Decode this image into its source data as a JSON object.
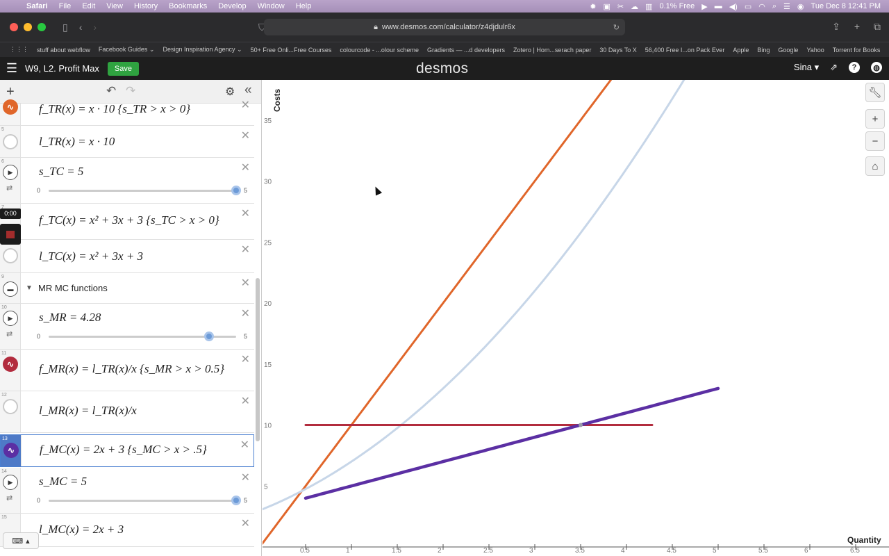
{
  "menubar": {
    "app": "Safari",
    "items": [
      "File",
      "Edit",
      "View",
      "History",
      "Bookmarks",
      "Develop",
      "Window",
      "Help"
    ],
    "status": {
      "memory": "0.1% Free",
      "datetime": "Tue Dec 8  12:41 PM"
    }
  },
  "browser": {
    "url": "www.desmos.com/calculator/z4djdulr6x",
    "bookmarks": [
      "stuff about webflow",
      "Facebook Guides ⌄",
      "Design Inspiration Agency ⌄",
      "50+ Free Onli...Free Courses",
      "colourcode - ...olour scheme",
      "Gradients — ...d developers",
      "Zotero | Hom...serach paper",
      "30 Days To X",
      "56,400 Free I...on Pack Ever",
      "Apple",
      "Bing",
      "Google",
      "Yahoo",
      "Torrent for Books"
    ]
  },
  "desmos_header": {
    "title": "W9, L2. Profit Max",
    "save_label": "Save",
    "logo": "desmos",
    "user": "Sina"
  },
  "expressions": {
    "rows": [
      {
        "num": "",
        "expr": "f_TR(x) = x · 10 {s_TR > x > 0}"
      },
      {
        "num": "5",
        "expr": "l_TR(x) = x · 10"
      },
      {
        "num": "6",
        "expr": "s_TC = 5",
        "slider_min": "0",
        "slider_max": "5"
      },
      {
        "num": "7",
        "expr": "f_TC(x) = x² + 3x + 3 {s_TC > x > 0}"
      },
      {
        "num": "",
        "expr": "l_TC(x) = x² + 3x + 3"
      },
      {
        "num": "9",
        "folder": "MR MC functions"
      },
      {
        "num": "10",
        "expr": "s_MR = 4.28",
        "slider_min": "0",
        "slider_max": "5"
      },
      {
        "num": "11",
        "expr": "f_MR(x) = l_TR(x)/x {s_MR > x > 0.5}"
      },
      {
        "num": "12",
        "expr": "l_MR(x) = l_TR(x)/x"
      },
      {
        "num": "13",
        "expr": "f_MC(x) = 2x + 3 {s_MC > x > .5}"
      },
      {
        "num": "14",
        "expr": "s_MC = 5",
        "slider_min": "0",
        "slider_max": "5"
      },
      {
        "num": "15",
        "expr": "l_MC(x) = 2x + 3"
      }
    ],
    "recording_time": "0:00"
  },
  "sliders": {
    "s_TC": 5,
    "s_MR": 4.28,
    "s_MC": 5
  },
  "chart_data": {
    "type": "line",
    "ylabel": "Costs",
    "xlabel": "Quantity",
    "xlim": [
      0,
      6.5
    ],
    "ylim": [
      0,
      35
    ],
    "x_ticks": [
      "0.5",
      "1",
      "1.5",
      "2",
      "2.5",
      "3",
      "3.5",
      "4",
      "4.5",
      "5",
      "5.5",
      "6",
      "6.5"
    ],
    "y_ticks": [
      "5",
      "10",
      "15",
      "20",
      "25",
      "30",
      "35"
    ],
    "series": [
      {
        "key": "l_TR",
        "color": "#e0662a",
        "formula": "10x",
        "domain": [
          0,
          5
        ]
      },
      {
        "key": "l_TC",
        "color": "#c7d6e8",
        "formula": "x^2+3x+3",
        "domain": [
          0,
          5
        ]
      },
      {
        "key": "f_MR",
        "color": "#b22c3e",
        "formula": "10",
        "domain": [
          0.5,
          4.28
        ]
      },
      {
        "key": "f_MC",
        "color": "#5b2fa3",
        "formula": "2x+3",
        "domain": [
          0.5,
          5
        ]
      }
    ],
    "intersection": {
      "x": 3.5,
      "y": 10
    }
  }
}
